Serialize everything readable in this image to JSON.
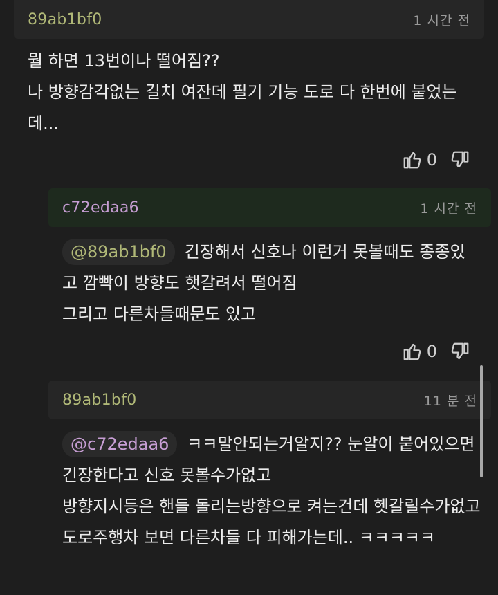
{
  "comments": [
    {
      "author": "89ab1bf0",
      "time": "1 시간 전",
      "text": "뭘 하면 13번이나 떨어짐??\n나 방향감각없는 길치 여잔데 필기 기능 도로 다 한번에 붙었는데...",
      "likes": "0"
    },
    {
      "author": "c72edaa6",
      "time": "1 시간 전",
      "mention": "@89ab1bf0",
      "text": "긴장해서 신호나 이런거 못볼때도 종종있고 깜빡이 방향도 햇갈려서 떨어짐\n그리고 다른차들때문도 있고",
      "likes": "0"
    },
    {
      "author": "89ab1bf0",
      "time": "11 분 전",
      "mention": "@c72edaa6",
      "text": "ㅋㅋ말안되는거알지?? 눈알이 붙어있으면 긴장한다고 신호 못볼수가없고\n방향지시등은 핸들 돌리는방향으로 켜는건데 헷갈릴수가없고\n도로주행차 보면 다른차들 다 피해가는데.. ㅋㅋㅋㅋㅋ"
    }
  ],
  "icons": {
    "like": "thumbs-up-icon",
    "dislike": "thumbs-down-icon"
  },
  "colors": {
    "author_olive": "#b0b877",
    "author_purple": "#c79ed4",
    "background": "#1e1e1e"
  }
}
